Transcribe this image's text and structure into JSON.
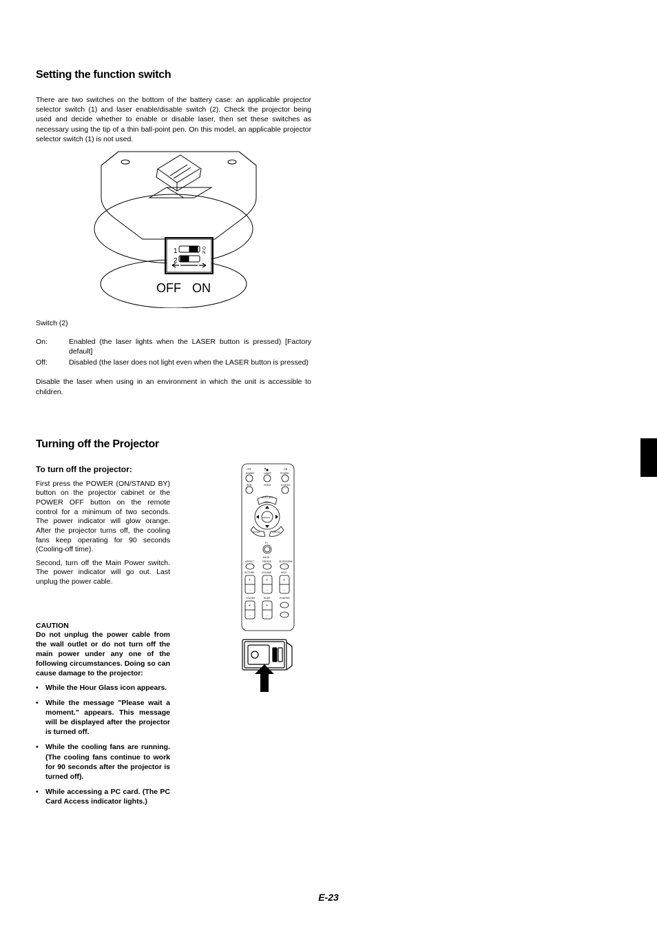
{
  "section1": {
    "heading": "Setting the function switch",
    "intro": "There are two switches on the bottom of the battery case: an applicable projector selector switch (1) and laser enable/disable switch (2). Check the projector being used and decide whether to enable or disable laser, then set these switches as necessary using the tip of a thin ball-point pen. On this model, an applicable projector selector switch (1) is not used.",
    "diagram": {
      "num1": "1",
      "num2": "2",
      "onLabel": "O N",
      "off": "OFF",
      "on": "ON"
    },
    "switchLabel": "Switch (2)",
    "defs": {
      "onKey": "On:",
      "onVal": "Enabled (the laser lights when the LASER button is pressed) [Factory default]",
      "offKey": "Off:",
      "offVal": "Disabled (the laser does not light even when the LASER button is pressed)"
    },
    "note": "Disable the laser when using in an environment in which the unit is accessible to children."
  },
  "section2": {
    "heading": "Turning off the Projector",
    "subheading": "To turn off the projector:",
    "para1": "First press the POWER (ON/STAND BY) button on the projector cabinet or the POWER OFF button on the remote control for a minimum of two seconds. The power indicator will glow orange. After the projector turns off, the cooling fans keep operating for 90 seconds (Cooling-off time).",
    "para2": "Second, turn off the Main Power switch. The power indicator will go out. Last unplug the power cable.",
    "remoteLabels": {
      "off": "OFF",
      "on": "ON",
      "power": "POWER",
      "laser": "LASER",
      "rgb": "RGB",
      "video": "VIDEO",
      "svideo": "S-VIDEO",
      "viewer": "VIEWER",
      "menu": "MENU",
      "select": "SELECT",
      "enter": "ENTER",
      "cancel": "CANCEL",
      "pic": "PIC",
      "mute": "MUTE",
      "aspect": "ASPECT",
      "freeze": "FREEZE",
      "picture": "PICTURE",
      "volume": "VOLUME",
      "dzoom": "3D REFORM",
      "help": "HELP",
      "slide": "SLIDE",
      "folder": "FOLDER",
      "pj": "PJ",
      "pointer": "POINTER"
    },
    "cautionHeading": "CAUTION",
    "cautionText": "Do not unplug the power cable from the wall outlet or do not turn off the main power under any one of the following circumstances. Doing so can cause damage to the projector:",
    "bullets": [
      "While the Hour Glass icon appears.",
      "While the message \"Please wait a moment.\" appears. This message will be displayed after the projector is turned off.",
      "While the cooling fans are running. (The cooling fans continue to work for 90 seconds after the projector is turned off).",
      "While accessing a PC card. (The PC Card Access indicator lights.)"
    ]
  },
  "pageNumber": "E-23"
}
